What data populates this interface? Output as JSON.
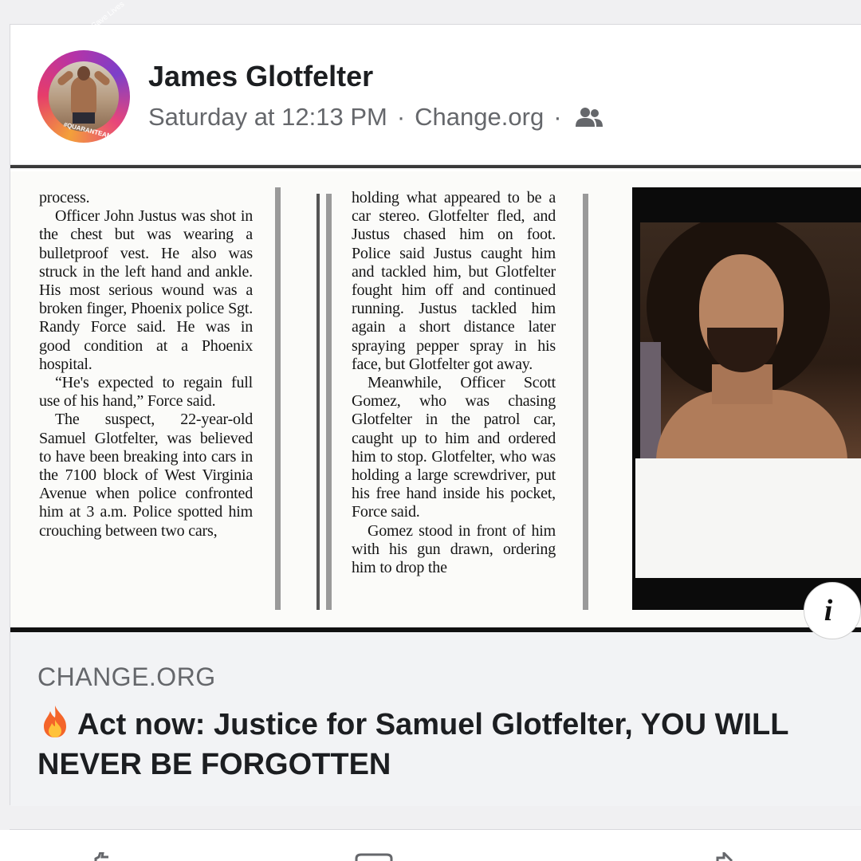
{
  "post": {
    "author": "James Glotfelter",
    "timestamp": "Saturday at 12:13 PM",
    "source": "Change.org",
    "separator": "·",
    "audience_icon": "friends-icon",
    "avatar_ring_text": "Stay Home ✿ Save Lives",
    "avatar_tag": "#QUARANTEAM"
  },
  "clipping": {
    "column1": [
      "process.",
      "Officer John Justus was shot in the chest but was wearing a bulletproof vest. He also was struck in the left hand and ankle. His most serious wound was a broken finger, Phoenix police Sgt. Randy Force said. He was in good condition at a Phoenix hospital.",
      "“He's expected to regain full use of his hand,” Force said.",
      "The suspect, 22-year-old Samuel Glotfelter, was believed to have been breaking into cars in the 7100 block of West Virginia Avenue when police confronted him at 3 a.m. Police spotted him crouching between two cars,"
    ],
    "column2": [
      "holding what appeared to be a car stereo. Glotfelter fled, and Justus chased him on foot. Police said Justus caught him and tackled him, but Glotfelter fought him off and continued running. Justus tackled him again a short distance later spraying pepper spray in his face, but Glotfelter got away.",
      "Meanwhile, Officer Scott Gomez, who was chasing Glotfelter in the patrol car, caught up to him and ordered him to stop. Glotfelter, who was holding a large screwdriver, put his free hand inside his pocket, Force said.",
      "Gomez stood in front of him with his gun drawn, ordering him to drop the"
    ]
  },
  "link": {
    "domain": "CHANGE.ORG",
    "title_icon": "fire-icon",
    "title": "Act now: Justice for Samuel Glotfelter, YOU WILL NEVER BE FORGOTTEN",
    "info_label": "i"
  },
  "actions": {
    "icons": [
      "like-icon",
      "comment-icon",
      "share-icon"
    ]
  }
}
